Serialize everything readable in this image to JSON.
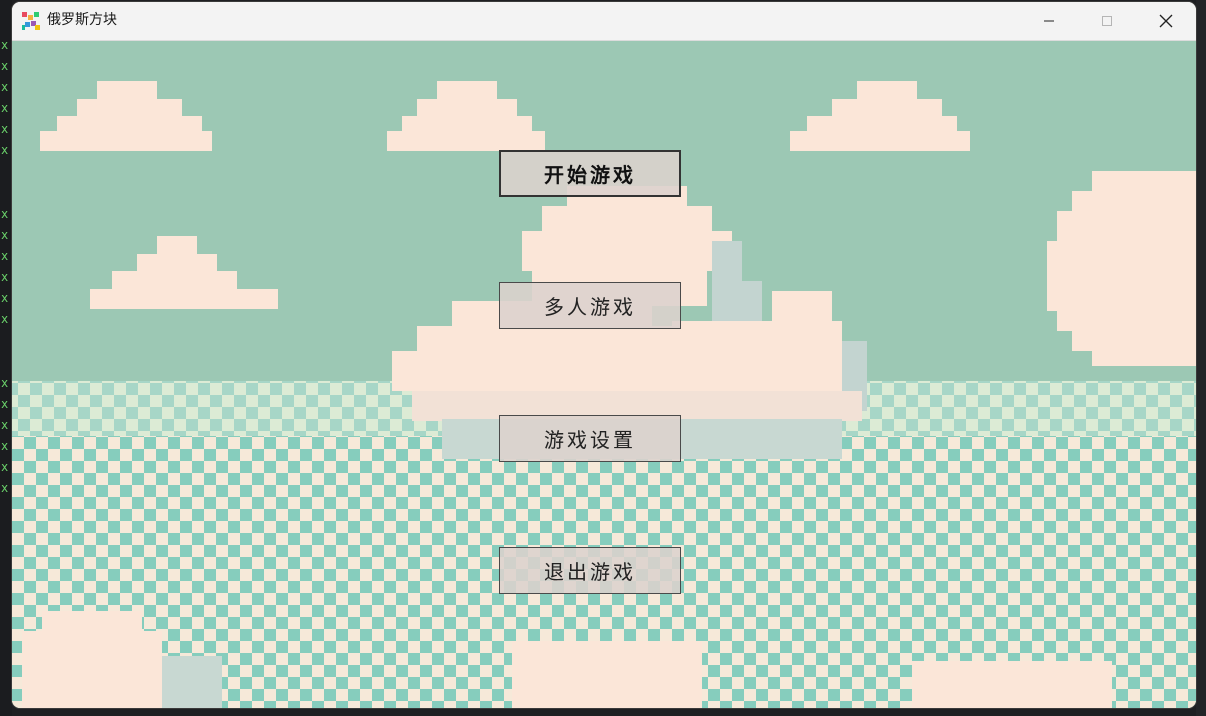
{
  "window": {
    "title": "俄罗斯方块",
    "app_icon": "tetris-colorful-icon",
    "controls": [
      "minimize-icon",
      "maximize-icon",
      "close-icon"
    ]
  },
  "desktop_behind": {
    "terminal_marks": [
      "x",
      "x",
      "x",
      "x",
      "x",
      "x",
      "x",
      "x",
      "x",
      "x",
      "x",
      "x",
      "x",
      "x",
      "x",
      "x",
      "x",
      "x"
    ]
  },
  "menu": {
    "start_game": "开始游戏",
    "multiplayer": "多人游戏",
    "settings": "游戏设置",
    "exit_game": "退出游戏"
  },
  "colors": {
    "sky": "#9cc8b4",
    "cloud": "#fbe6d8",
    "cloud_shadow": "#c3d4d0",
    "checker_light": "#f6e9d9",
    "checker_teal": "#86cdbd",
    "button_bg": "#dcd2cd",
    "button_border": "#4a4a4a"
  }
}
